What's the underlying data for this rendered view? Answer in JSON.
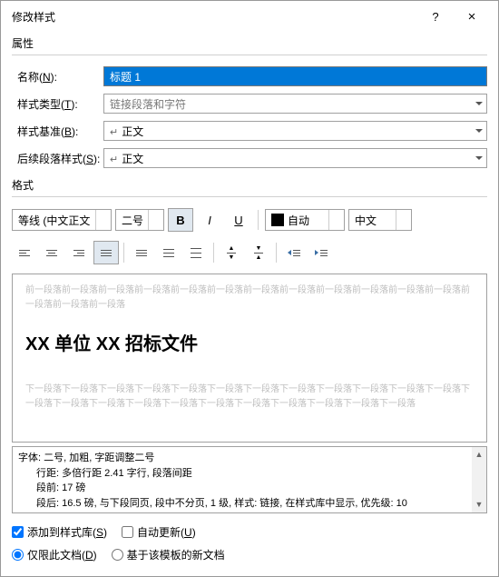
{
  "titlebar": {
    "title": "修改样式",
    "help": "?",
    "close": "×"
  },
  "sections": {
    "properties": "属性",
    "format": "格式"
  },
  "props": {
    "name": {
      "label_pre": "名称(",
      "accel": "N",
      "label_post": "):",
      "value": "标题 1"
    },
    "type": {
      "label_pre": "样式类型(",
      "accel": "T",
      "label_post": "):",
      "value": "链接段落和字符"
    },
    "based": {
      "label_pre": "样式基准(",
      "accel": "B",
      "label_post": "):",
      "value": "正文"
    },
    "following": {
      "label_pre": "后续段落样式(",
      "accel": "S",
      "label_post": "):",
      "value": "正文"
    }
  },
  "format": {
    "font": "等线 (中文正文",
    "size": "二号",
    "bold": "B",
    "italic": "I",
    "underline": "U",
    "color": "自动",
    "lang": "中文"
  },
  "preview": {
    "before": "前一段落前一段落前一段落前一段落前一段落前一段落前一段落前一段落前一段落前一段落前一段落前一段落前一段落前一段落前一段落",
    "sample": "XX 单位 XX 招标文件",
    "after": "下一段落下一段落下一段落下一段落下一段落下一段落下一段落下一段落下一段落下一段落下一段落下一段落下一段落下一段落下一段落下一段落下一段落下一段落下一段落下一段落下一段落下一段落下一段落"
  },
  "description": {
    "line1": "字体: 二号, 加粗, 字距调整二号",
    "line2": "行距: 多倍行距 2.41 字行, 段落间距",
    "line3": "段前: 17 磅",
    "line4": "段后: 16.5 磅, 与下段同页, 段中不分页, 1 级, 样式: 链接, 在样式库中显示, 优先级: 10"
  },
  "options": {
    "addToGallery": {
      "label_pre": "添加到样式库(",
      "accel": "S",
      "label_post": ")"
    },
    "autoUpdate": {
      "label_pre": "自动更新(",
      "accel": "U",
      "label_post": ")"
    },
    "onlyThisDoc": {
      "label_pre": "仅限此文档(",
      "accel": "D",
      "label_post": ")"
    },
    "templateDocs": {
      "label": "基于该模板的新文档"
    }
  }
}
